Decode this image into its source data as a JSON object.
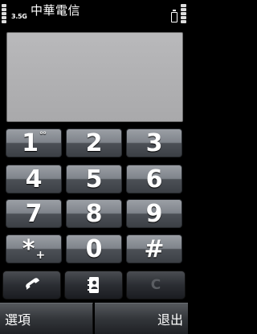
{
  "status": {
    "carrier": "中華電信",
    "network": "3.5G"
  },
  "display": {
    "number": ""
  },
  "keypad": {
    "keys": [
      {
        "main": "1",
        "sub": "°°"
      },
      {
        "main": "2"
      },
      {
        "main": "3"
      },
      {
        "main": "4"
      },
      {
        "main": "5"
      },
      {
        "main": "6"
      },
      {
        "main": "7"
      },
      {
        "main": "8"
      },
      {
        "main": "9"
      },
      {
        "main": "*",
        "sub": "+"
      },
      {
        "main": "0"
      },
      {
        "main": "#"
      }
    ]
  },
  "actions": {
    "call_icon": "phone-handset-icon",
    "contacts_icon": "contacts-book-icon",
    "clear_label": "C"
  },
  "softkeys": {
    "left": "選項",
    "right": "退出"
  },
  "colors": {
    "display": "#b4b4b6",
    "key_top": "#9b9fa5",
    "key_bottom": "#3c4045"
  }
}
